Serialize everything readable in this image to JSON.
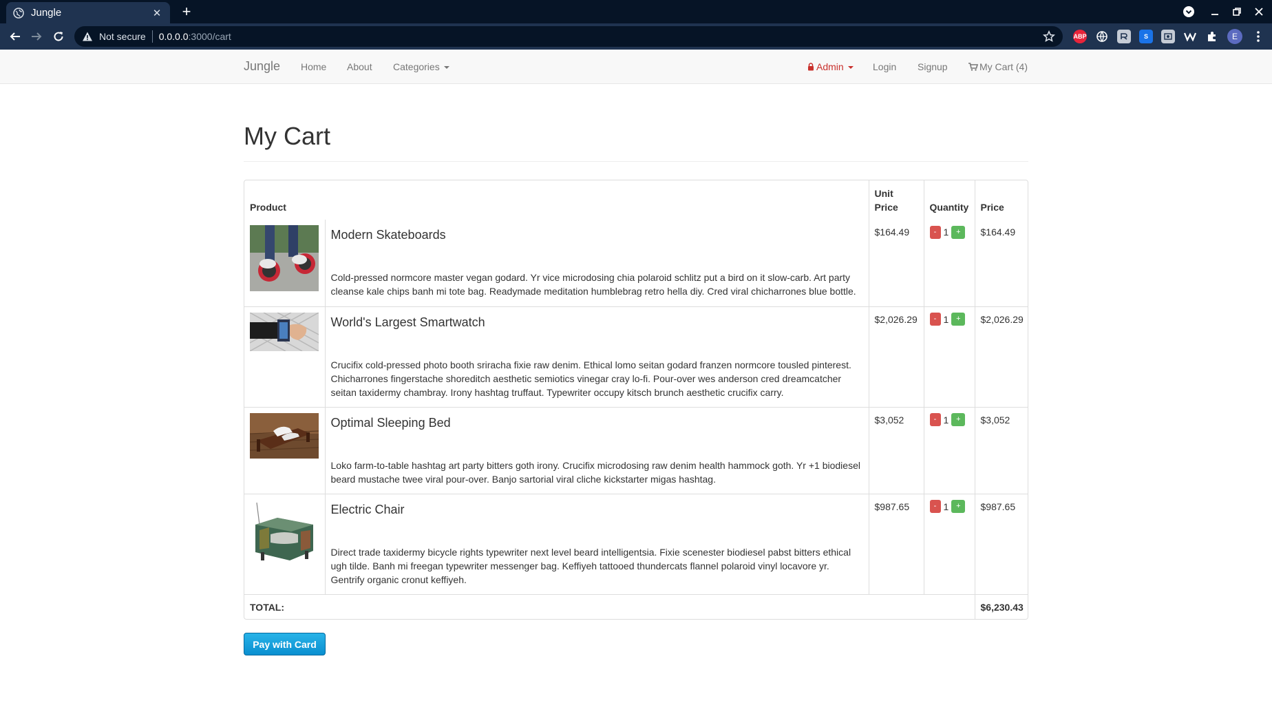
{
  "browser": {
    "tab_title": "Jungle",
    "tab_close": "✕",
    "new_tab": "+",
    "security_label": "Not secure",
    "url_host": "0.0.0.0",
    "url_path": ":3000/cart",
    "profile_initial": "E",
    "extensions": [
      {
        "name": "ABP",
        "color": "#e8243a"
      },
      {
        "name": "S",
        "color": "#1a73e8"
      }
    ]
  },
  "navbar": {
    "brand": "Jungle",
    "home": "Home",
    "about": "About",
    "categories": "Categories",
    "admin": "Admin",
    "login": "Login",
    "signup": "Signup",
    "cart": "My Cart (4)"
  },
  "page": {
    "title": "My Cart"
  },
  "cart": {
    "headers": {
      "product": "Product",
      "unit_price_line1": "Unit",
      "unit_price_line2": "Price",
      "quantity": "Quantity",
      "price": "Price"
    },
    "items": [
      {
        "name": "Modern Skateboards",
        "description": "Cold-pressed normcore master vegan godard. Yr vice microdosing chia polaroid schlitz put a bird on it slow-carb. Art party cleanse kale chips banh mi tote bag. Readymade meditation humblebrag retro hella diy. Cred viral chicharrones blue bottle.",
        "unit_price": "$164.49",
        "quantity": "1",
        "price": "$164.49"
      },
      {
        "name": "World's Largest Smartwatch",
        "description": "Crucifix cold-pressed photo booth sriracha fixie raw denim. Ethical lomo seitan godard franzen normcore tousled pinterest. Chicharrones fingerstache shoreditch aesthetic semiotics vinegar cray lo-fi. Pour-over wes anderson cred dreamcatcher seitan taxidermy chambray. Irony hashtag truffaut. Typewriter occupy kitsch brunch aesthetic crucifix carry.",
        "unit_price": "$2,026.29",
        "quantity": "1",
        "price": "$2,026.29"
      },
      {
        "name": "Optimal Sleeping Bed",
        "description": "Loko farm-to-table hashtag art party bitters goth irony. Crucifix microdosing raw denim health hammock goth. Yr +1 biodiesel beard mustache twee viral pour-over. Banjo sartorial viral cliche kickstarter migas hashtag.",
        "unit_price": "$3,052",
        "quantity": "1",
        "price": "$3,052"
      },
      {
        "name": "Electric Chair",
        "description": "Direct trade taxidermy bicycle rights typewriter next level beard intelligentsia. Fixie scenester biodiesel pabst bitters ethical ugh tilde. Banh mi freegan typewriter messenger bag. Keffiyeh tattooed thundercats flannel polaroid vinyl locavore yr. Gentrify organic cronut keffiyeh.",
        "unit_price": "$987.65",
        "quantity": "1",
        "price": "$987.65"
      }
    ],
    "qty_minus": "-",
    "qty_plus": "+",
    "total_label": "TOTAL:",
    "total_value": "$6,230.43"
  },
  "actions": {
    "pay_button": "Pay with Card"
  },
  "colors": {
    "danger": "#d9534f",
    "success": "#5cb85c",
    "admin_red": "#c9302c",
    "pay_blue": "#0a8fd0"
  }
}
